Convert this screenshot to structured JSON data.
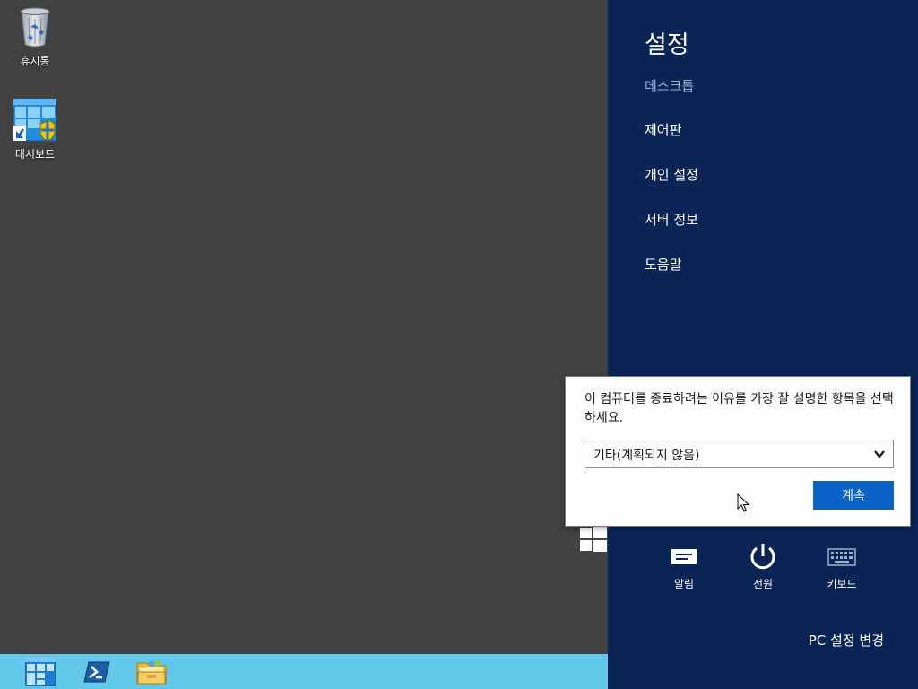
{
  "desktop": {
    "background_color": "#414141",
    "icons": [
      {
        "label": "휴지통",
        "icon": "recycle-bin-icon"
      },
      {
        "label": "대시보드",
        "icon": "dashboard-shortcut-icon"
      }
    ]
  },
  "taskbar": {
    "background_color": "#61c8e9",
    "buttons": [
      {
        "name": "start",
        "icon": "start-tiles-icon"
      },
      {
        "name": "powershell",
        "icon": "powershell-icon"
      },
      {
        "name": "explorer",
        "icon": "folder-icon"
      }
    ]
  },
  "charm_pane": {
    "background_color": "#0a2456",
    "title": "설정",
    "context": "데스크톱",
    "links": [
      "제어판",
      "개인 설정",
      "서버 정보",
      "도움말"
    ],
    "quick_actions": [
      {
        "label": "알림",
        "icon": "notifications-icon"
      },
      {
        "label": "전원",
        "icon": "power-icon"
      },
      {
        "label": "키보드",
        "icon": "keyboard-icon"
      }
    ],
    "pc_settings_label": "PC 설정 변경"
  },
  "shutdown_flyout": {
    "prompt": "이 컴퓨터를 종료하려는 이유를 가장 잘 설명한 항목을 선택하세요.",
    "reason_selected": "기타(계획되지 않음)",
    "continue_label": "계속",
    "accent_color": "#0a64c8"
  }
}
